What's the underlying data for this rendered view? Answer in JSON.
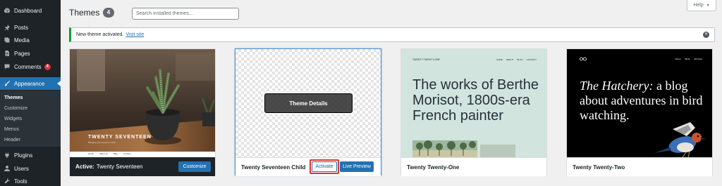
{
  "sidebar": {
    "items": [
      {
        "label": "Dashboard",
        "icon": "dashboard-icon"
      },
      {
        "label": "Posts",
        "icon": "pin-icon"
      },
      {
        "label": "Media",
        "icon": "media-icon"
      },
      {
        "label": "Pages",
        "icon": "page-icon"
      },
      {
        "label": "Comments",
        "icon": "comment-icon",
        "badge": "4"
      },
      {
        "label": "Appearance",
        "icon": "brush-icon"
      },
      {
        "label": "Plugins",
        "icon": "plug-icon"
      },
      {
        "label": "Users",
        "icon": "user-icon"
      },
      {
        "label": "Tools",
        "icon": "wrench-icon"
      }
    ],
    "submenu": [
      "Themes",
      "Customize",
      "Widgets",
      "Menus",
      "Header"
    ]
  },
  "header": {
    "title": "Themes",
    "count": "4",
    "search_placeholder": "Search installed themes...",
    "help_label": "Help",
    "help_caret": "▼"
  },
  "notice": {
    "text": "New theme activated.",
    "link": "Visit site",
    "dismiss_glyph": "✕"
  },
  "themes": [
    {
      "name": "Twenty Seventeen",
      "active_label": "Active:",
      "action": "Customize",
      "preview": {
        "site_title": "TWENTY SEVENTEEN",
        "tagline": "Bringing your business online...",
        "nav": [
          "Home",
          "About us",
          "Blog",
          "Contact"
        ]
      }
    },
    {
      "name": "Twenty Seventeen Child",
      "details_label": "Theme Details",
      "activate_label": "Activate",
      "preview_label": "Live Preview"
    },
    {
      "name": "Twenty Twenty-One",
      "preview": {
        "site_title": "TWENTY TWENTY-ONE",
        "nav": [
          "HOME",
          "ABOUT",
          "BLOG",
          "CONTACT"
        ],
        "headline": "The works of Berthe Morisot, 1800s-era French painter"
      }
    },
    {
      "name": "Twenty Twenty-Two",
      "preview": {
        "nav": [
          "About",
          "Birds",
          "All Posts"
        ],
        "headline_italic": "The Hatchery:",
        "headline_rest": " a blog about adventures in bird watching."
      }
    }
  ],
  "colors": {
    "sidebar_bg": "#1d2327",
    "accent": "#2271b1",
    "notice_success": "#00a32a",
    "badge": "#d63638",
    "t21_bg": "#d1e4dd"
  }
}
